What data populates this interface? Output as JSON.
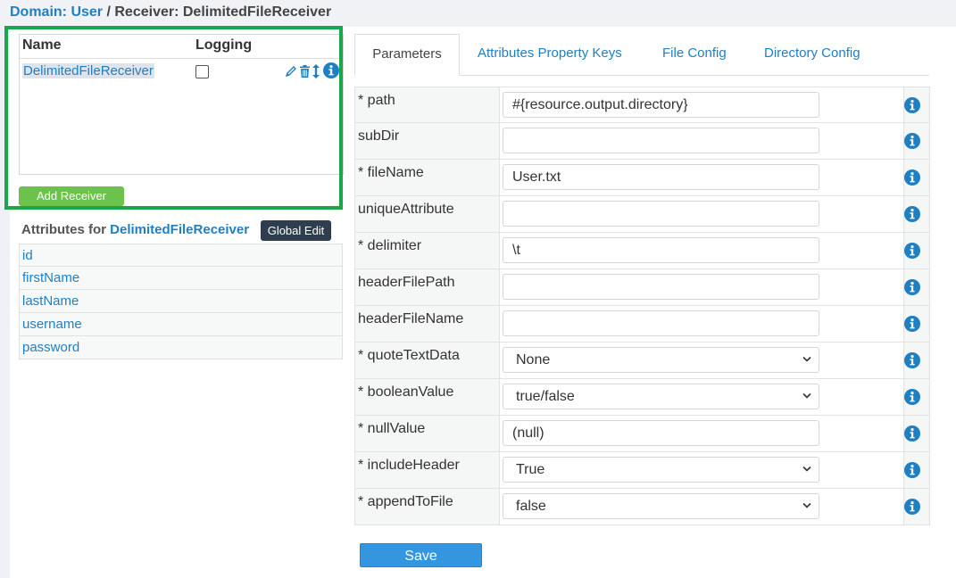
{
  "breadcrumb": {
    "domain_label": "Domain: User",
    "separator": " / ",
    "receiver_label": "Receiver: DelimitedFileReceiver"
  },
  "receivers": {
    "col_name": "Name",
    "col_logging": "Logging",
    "rows": [
      {
        "name": "DelimitedFileReceiver",
        "logging": false
      }
    ],
    "add_button": "Add Receiver"
  },
  "attributes": {
    "title_prefix": "Attributes for ",
    "title_receiver": "DelimitedFileReceiver",
    "global_edit": "Global Edit",
    "items": [
      "id",
      "firstName",
      "lastName",
      "username",
      "password"
    ]
  },
  "tabs": [
    "Parameters",
    "Attributes Property Keys",
    "File Config",
    "Directory Config"
  ],
  "active_tab": "Parameters",
  "params": [
    {
      "label": "* path",
      "type": "input",
      "value": "#{resource.output.directory}"
    },
    {
      "label": "subDir",
      "type": "input",
      "value": ""
    },
    {
      "label": "* fileName",
      "type": "input",
      "value": "User.txt"
    },
    {
      "label": "uniqueAttribute",
      "type": "input",
      "value": ""
    },
    {
      "label": "* delimiter",
      "type": "input",
      "value": "\\t"
    },
    {
      "label": "headerFilePath",
      "type": "input",
      "value": ""
    },
    {
      "label": "headerFileName",
      "type": "input",
      "value": ""
    },
    {
      "label": "* quoteTextData",
      "type": "select",
      "value": "None"
    },
    {
      "label": "* booleanValue",
      "type": "select",
      "value": "true/false"
    },
    {
      "label": "* nullValue",
      "type": "input",
      "value": "(null)"
    },
    {
      "label": "* includeHeader",
      "type": "select",
      "value": "True"
    },
    {
      "label": "* appendToFile",
      "type": "select",
      "value": "false"
    }
  ],
  "save_button": "Save",
  "colors": {
    "link": "#1f7fc3",
    "highlight_box": "#1aa64a",
    "add_button": "#6cc24a",
    "global_edit": "#2f3e4e",
    "save_button": "#3496de",
    "info_icon": "#1f7fc3"
  },
  "icons": {
    "edit": "pencil-icon",
    "delete": "trash-icon",
    "reorder": "sort-icon",
    "info": "info-icon",
    "dropdown": "chevron-down-icon"
  }
}
